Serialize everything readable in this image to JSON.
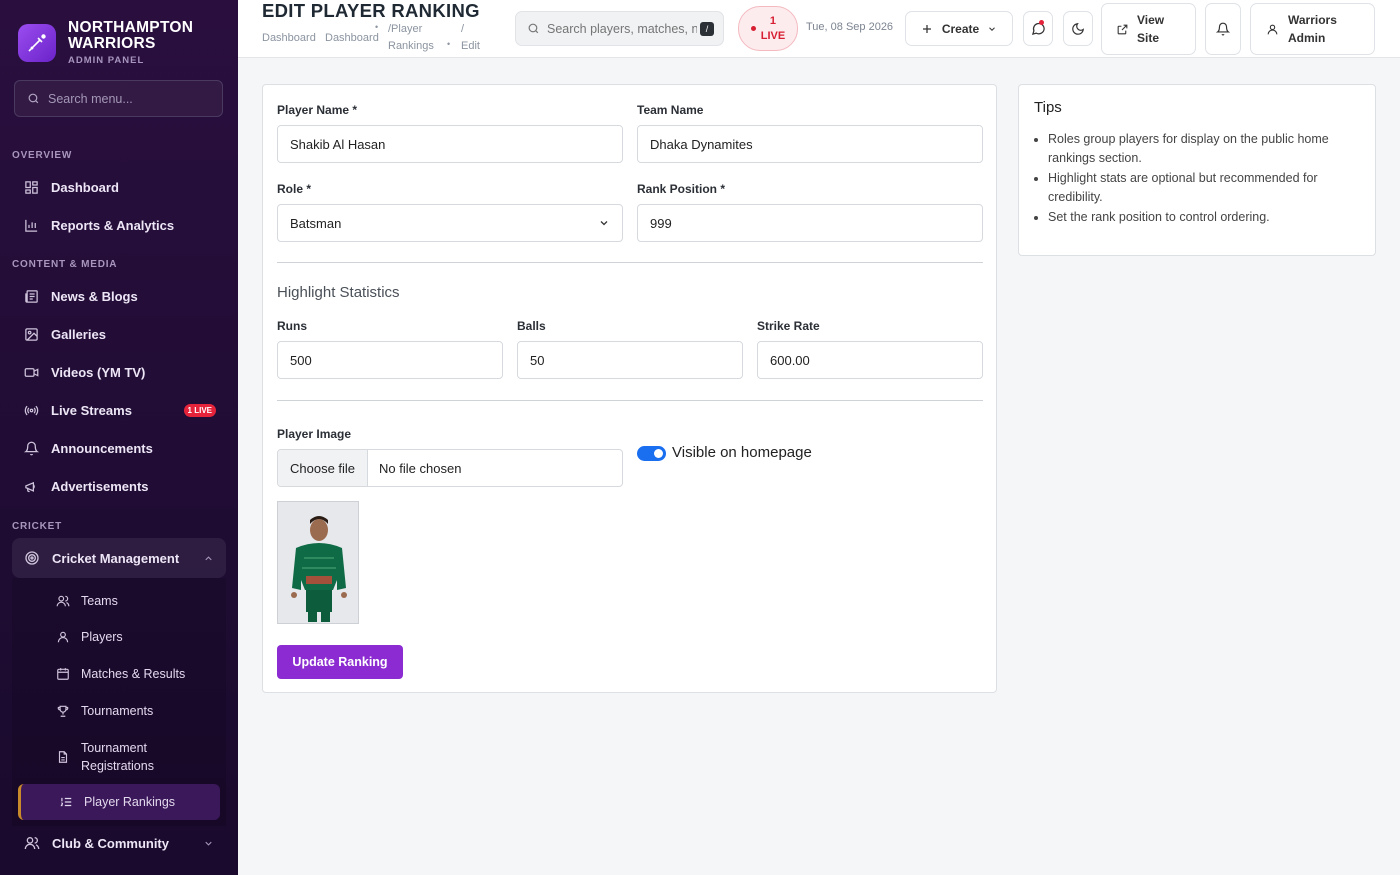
{
  "brand": {
    "name_line1": "NORTHAMPTON",
    "name_line2": "WARRIORS",
    "subtitle": "ADMIN PANEL"
  },
  "sidebar": {
    "search_placeholder": "Search menu...",
    "sections": {
      "overview": "OVERVIEW",
      "content": "CONTENT & MEDIA",
      "cricket": "CRICKET"
    },
    "items": {
      "dashboard": "Dashboard",
      "reports": "Reports & Analytics",
      "news": "News & Blogs",
      "galleries": "Galleries",
      "videos": "Videos (YM TV)",
      "live_streams": "Live Streams",
      "live_badge": "1 LIVE",
      "announcements": "Announcements",
      "advertisements": "Advertisements",
      "cricket_mgmt": "Cricket Management",
      "teams": "Teams",
      "players": "Players",
      "matches": "Matches & Results",
      "tournaments": "Tournaments",
      "tour_reg_line1": "Tournament",
      "tour_reg_line2": "Registrations",
      "player_rankings": "Player Rankings",
      "club": "Club & Community"
    }
  },
  "topbar": {
    "title": "EDIT PLAYER RANKING",
    "breadcrumb": {
      "c1": "Dashboard",
      "c2": "Dashboard",
      "c3a": "/Player",
      "c3b": "Rankings",
      "c4a": "/",
      "c4b": "Edit"
    },
    "search_placeholder": "Search players, matches, news...",
    "kbd": "/",
    "live_count": "1",
    "live_label": "LIVE",
    "date": "Tue, 08 Sep 2026",
    "create_label": "Create",
    "view_site_line1": "View",
    "view_site_line2": "Site",
    "user_line1": "Warriors",
    "user_line2": "Admin"
  },
  "form": {
    "player_name_label": "Player Name *",
    "player_name_value": "Shakib Al Hasan",
    "team_name_label": "Team Name",
    "team_name_value": "Dhaka Dynamites",
    "role_label": "Role *",
    "role_value": "Batsman",
    "rank_label": "Rank Position *",
    "rank_value": "999",
    "stats_title": "Highlight Statistics",
    "runs_label": "Runs",
    "runs_value": "500",
    "balls_label": "Balls",
    "balls_value": "50",
    "sr_label": "Strike Rate",
    "sr_value": "600.00",
    "image_label": "Player Image",
    "choose_file": "Choose file",
    "no_file": "No file chosen",
    "visible_label": "Visible on homepage",
    "submit_label": "Update Ranking"
  },
  "tips": {
    "title": "Tips",
    "items": [
      "Roles group players for display on the public home rankings section.",
      "Highlight stats are optional but recommended for credibility.",
      "Set the rank position to control ordering."
    ]
  },
  "colors": {
    "accent": "#8b2bd1",
    "sidebar_bg": "#2a0f3e",
    "toggle_on": "#1a6ef0",
    "live_red": "#d61f32"
  }
}
